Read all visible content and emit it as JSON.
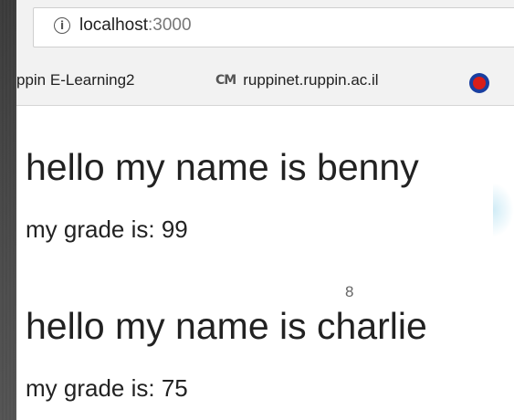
{
  "browser": {
    "url_host": "localhost",
    "url_port": ":3000",
    "info_icon": "info-icon"
  },
  "bookmarks": [
    {
      "label": "ppin E-Learning2"
    },
    {
      "label": "ruppinet.ruppin.ac.il",
      "icon": "cm-logo-icon"
    },
    {
      "icon": "ruppin-logo-icon"
    }
  ],
  "page": {
    "greetings": [
      {
        "heading": "hello my name is benny",
        "grade": "my grade is: 99"
      },
      {
        "heading": "hello my name is charlie",
        "grade": "my grade is: 75"
      }
    ]
  },
  "slide": {
    "number": "8"
  }
}
